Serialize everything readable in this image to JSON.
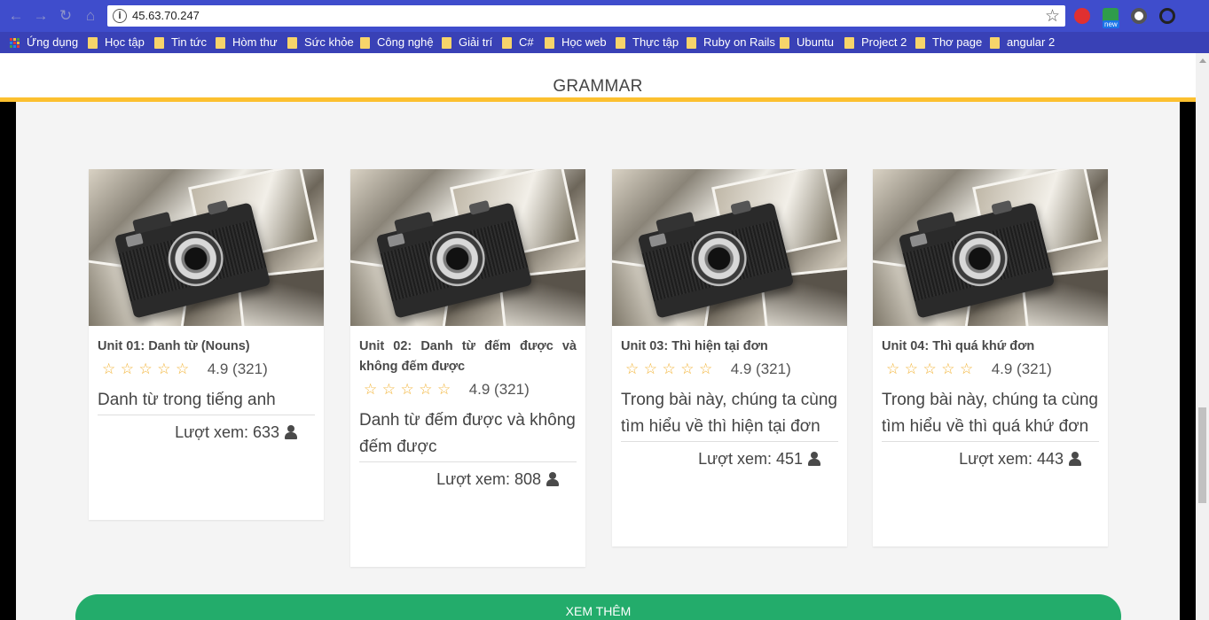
{
  "browser": {
    "url": "45.63.70.247",
    "bookmarks": [
      {
        "label": "Ứng dụng",
        "type": "apps"
      },
      {
        "label": "Học tập"
      },
      {
        "label": "Tin tức"
      },
      {
        "label": "Hòm thư"
      },
      {
        "label": "Sức khỏe"
      },
      {
        "label": "Công nghệ"
      },
      {
        "label": "Giải trí"
      },
      {
        "label": "C#"
      },
      {
        "label": "Học web"
      },
      {
        "label": "Thực tập"
      },
      {
        "label": "Ruby on Rails"
      },
      {
        "label": "Ubuntu"
      },
      {
        "label": "Project 2"
      },
      {
        "label": "Thơ page"
      },
      {
        "label": "angular 2"
      }
    ],
    "extension_badge": "new"
  },
  "header": {
    "title": "GRAMMAR",
    "accent_color": "#fcc02f"
  },
  "cards": [
    {
      "title": "Unit 01: Danh từ (Nouns)",
      "stars": "☆☆☆☆☆",
      "rating": "4.9 (321)",
      "description": "Danh từ trong tiếng anh",
      "views": "Lượt xem: 633"
    },
    {
      "title": "Unit 02: Danh từ đếm được và không đếm được",
      "stars": "☆☆☆☆☆",
      "rating": "4.9 (321)",
      "description": "Danh từ đếm được và không đếm được",
      "views": "Lượt xem: 808"
    },
    {
      "title": "Unit 03: Thì hiện tại đơn",
      "stars": "☆☆☆☆☆",
      "rating": "4.9 (321)",
      "description": "Trong bài này, chúng ta cùng tìm hiểu về thì hiện tại đơn",
      "views": "Lượt xem: 451"
    },
    {
      "title": "Unit 04: Thì quá khứ đơn",
      "stars": "☆☆☆☆☆",
      "rating": "4.9 (321)",
      "description": "Trong bài này, chúng ta cùng tìm hiểu về thì quá khứ đơn",
      "views": "Lượt xem: 443"
    }
  ],
  "more_button": {
    "label": "XEM THÊM",
    "color": "#23ac6b"
  }
}
